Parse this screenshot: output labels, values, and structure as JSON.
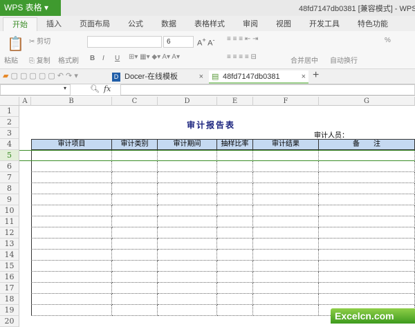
{
  "app": {
    "button": "WPS 表格",
    "doc_title": "48fd7147db0381 [兼容模式] - WPS"
  },
  "menu_tabs": [
    "开始",
    "插入",
    "页面布局",
    "公式",
    "数据",
    "表格样式",
    "审阅",
    "视图",
    "开发工具",
    "特色功能"
  ],
  "ribbon": {
    "paste": "粘贴",
    "cut": "剪切",
    "copy": "复制",
    "format_painter": "格式刷",
    "font_size": "6",
    "bold": "B",
    "italic": "I",
    "underline": "U",
    "merge": "合并居中",
    "wrap": "自动换行",
    "percent": "%"
  },
  "doc_tabs": [
    {
      "label": "Docer-在线模板"
    },
    {
      "label": "48fd7147db0381"
    }
  ],
  "formula": {
    "fx": "fx",
    "name_box": "",
    "content": ""
  },
  "columns": [
    "A",
    "B",
    "C",
    "D",
    "E",
    "F",
    "G"
  ],
  "rows": [
    "1",
    "2",
    "3",
    "4",
    "5",
    "6",
    "7",
    "8",
    "9",
    "10",
    "11",
    "12",
    "13",
    "14",
    "15",
    "16",
    "17",
    "18",
    "19",
    "20"
  ],
  "sheet": {
    "title": "审计报告表",
    "auditor_label": "审计人员：",
    "headers": [
      "审计项目",
      "审计类别",
      "审计期间",
      "抽样比率",
      "审计结果",
      "备　　注"
    ]
  },
  "watermark": "Excelcn.com"
}
